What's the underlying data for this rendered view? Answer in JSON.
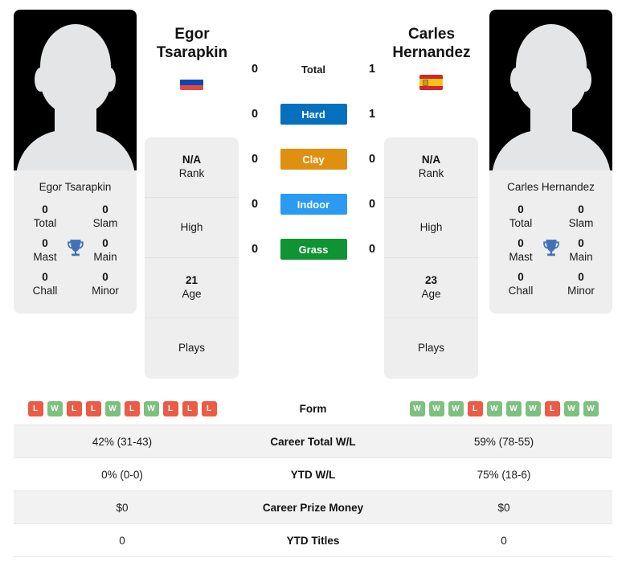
{
  "players": {
    "left": {
      "first_name": "Egor",
      "last_name": "Tsarapkin",
      "full_name": "Egor Tsarapkin",
      "country": "Russia",
      "flag_icon": "flag-russia-icon",
      "avatar_icon": "player-avatar-placeholder-icon",
      "rank": "N/A",
      "rank_label": "Rank",
      "high_label": "High",
      "high_value": "",
      "age": "21",
      "age_label": "Age",
      "plays_label": "Plays",
      "plays_value": "",
      "titles": {
        "total": {
          "value": "0",
          "label": "Total"
        },
        "slam": {
          "value": "0",
          "label": "Slam"
        },
        "mast": {
          "value": "0",
          "label": "Mast"
        },
        "main": {
          "value": "0",
          "label": "Main"
        },
        "chall": {
          "value": "0",
          "label": "Chall"
        },
        "minor": {
          "value": "0",
          "label": "Minor"
        }
      },
      "form": [
        "L",
        "W",
        "L",
        "L",
        "W",
        "L",
        "W",
        "L",
        "L",
        "L"
      ]
    },
    "right": {
      "first_name": "Carles",
      "last_name": "Hernandez",
      "full_name": "Carles Hernandez",
      "country": "Spain",
      "flag_icon": "flag-spain-icon",
      "avatar_icon": "player-avatar-placeholder-icon",
      "rank": "N/A",
      "rank_label": "Rank",
      "high_label": "High",
      "high_value": "",
      "age": "23",
      "age_label": "Age",
      "plays_label": "Plays",
      "plays_value": "",
      "titles": {
        "total": {
          "value": "0",
          "label": "Total"
        },
        "slam": {
          "value": "0",
          "label": "Slam"
        },
        "mast": {
          "value": "0",
          "label": "Mast"
        },
        "main": {
          "value": "0",
          "label": "Main"
        },
        "chall": {
          "value": "0",
          "label": "Chall"
        },
        "minor": {
          "value": "0",
          "label": "Minor"
        }
      },
      "form": [
        "W",
        "W",
        "W",
        "L",
        "W",
        "W",
        "W",
        "L",
        "W",
        "W"
      ]
    }
  },
  "head_to_head": [
    {
      "label": "Total",
      "left": "0",
      "right": "1",
      "color": "",
      "badge": false
    },
    {
      "label": "Hard",
      "left": "0",
      "right": "1",
      "color": "#0570bd",
      "badge": true
    },
    {
      "label": "Clay",
      "left": "0",
      "right": "0",
      "color": "#e09010",
      "badge": true
    },
    {
      "label": "Indoor",
      "left": "0",
      "right": "0",
      "color": "#2b9af3",
      "badge": true
    },
    {
      "label": "Grass",
      "left": "0",
      "right": "0",
      "color": "#109433",
      "badge": true
    }
  ],
  "trophy_icon": "trophy-icon",
  "trophy_color": "#3f72b8",
  "stats_table": [
    {
      "label": "Form",
      "left": "",
      "right": "",
      "is_form": true
    },
    {
      "label": "Career Total W/L",
      "left": "42% (31-43)",
      "right": "59% (78-55)",
      "is_form": false
    },
    {
      "label": "YTD W/L",
      "left": "0% (0-0)",
      "right": "75% (18-6)",
      "is_form": false
    },
    {
      "label": "Career Prize Money",
      "left": "$0",
      "right": "$0",
      "is_form": false
    },
    {
      "label": "YTD Titles",
      "left": "0",
      "right": "0",
      "is_form": false
    }
  ],
  "colors": {
    "win": "#7dc17f",
    "loss": "#ec5b45",
    "card_bg": "#eeeeee",
    "row_alt": "#f2f2f2"
  }
}
